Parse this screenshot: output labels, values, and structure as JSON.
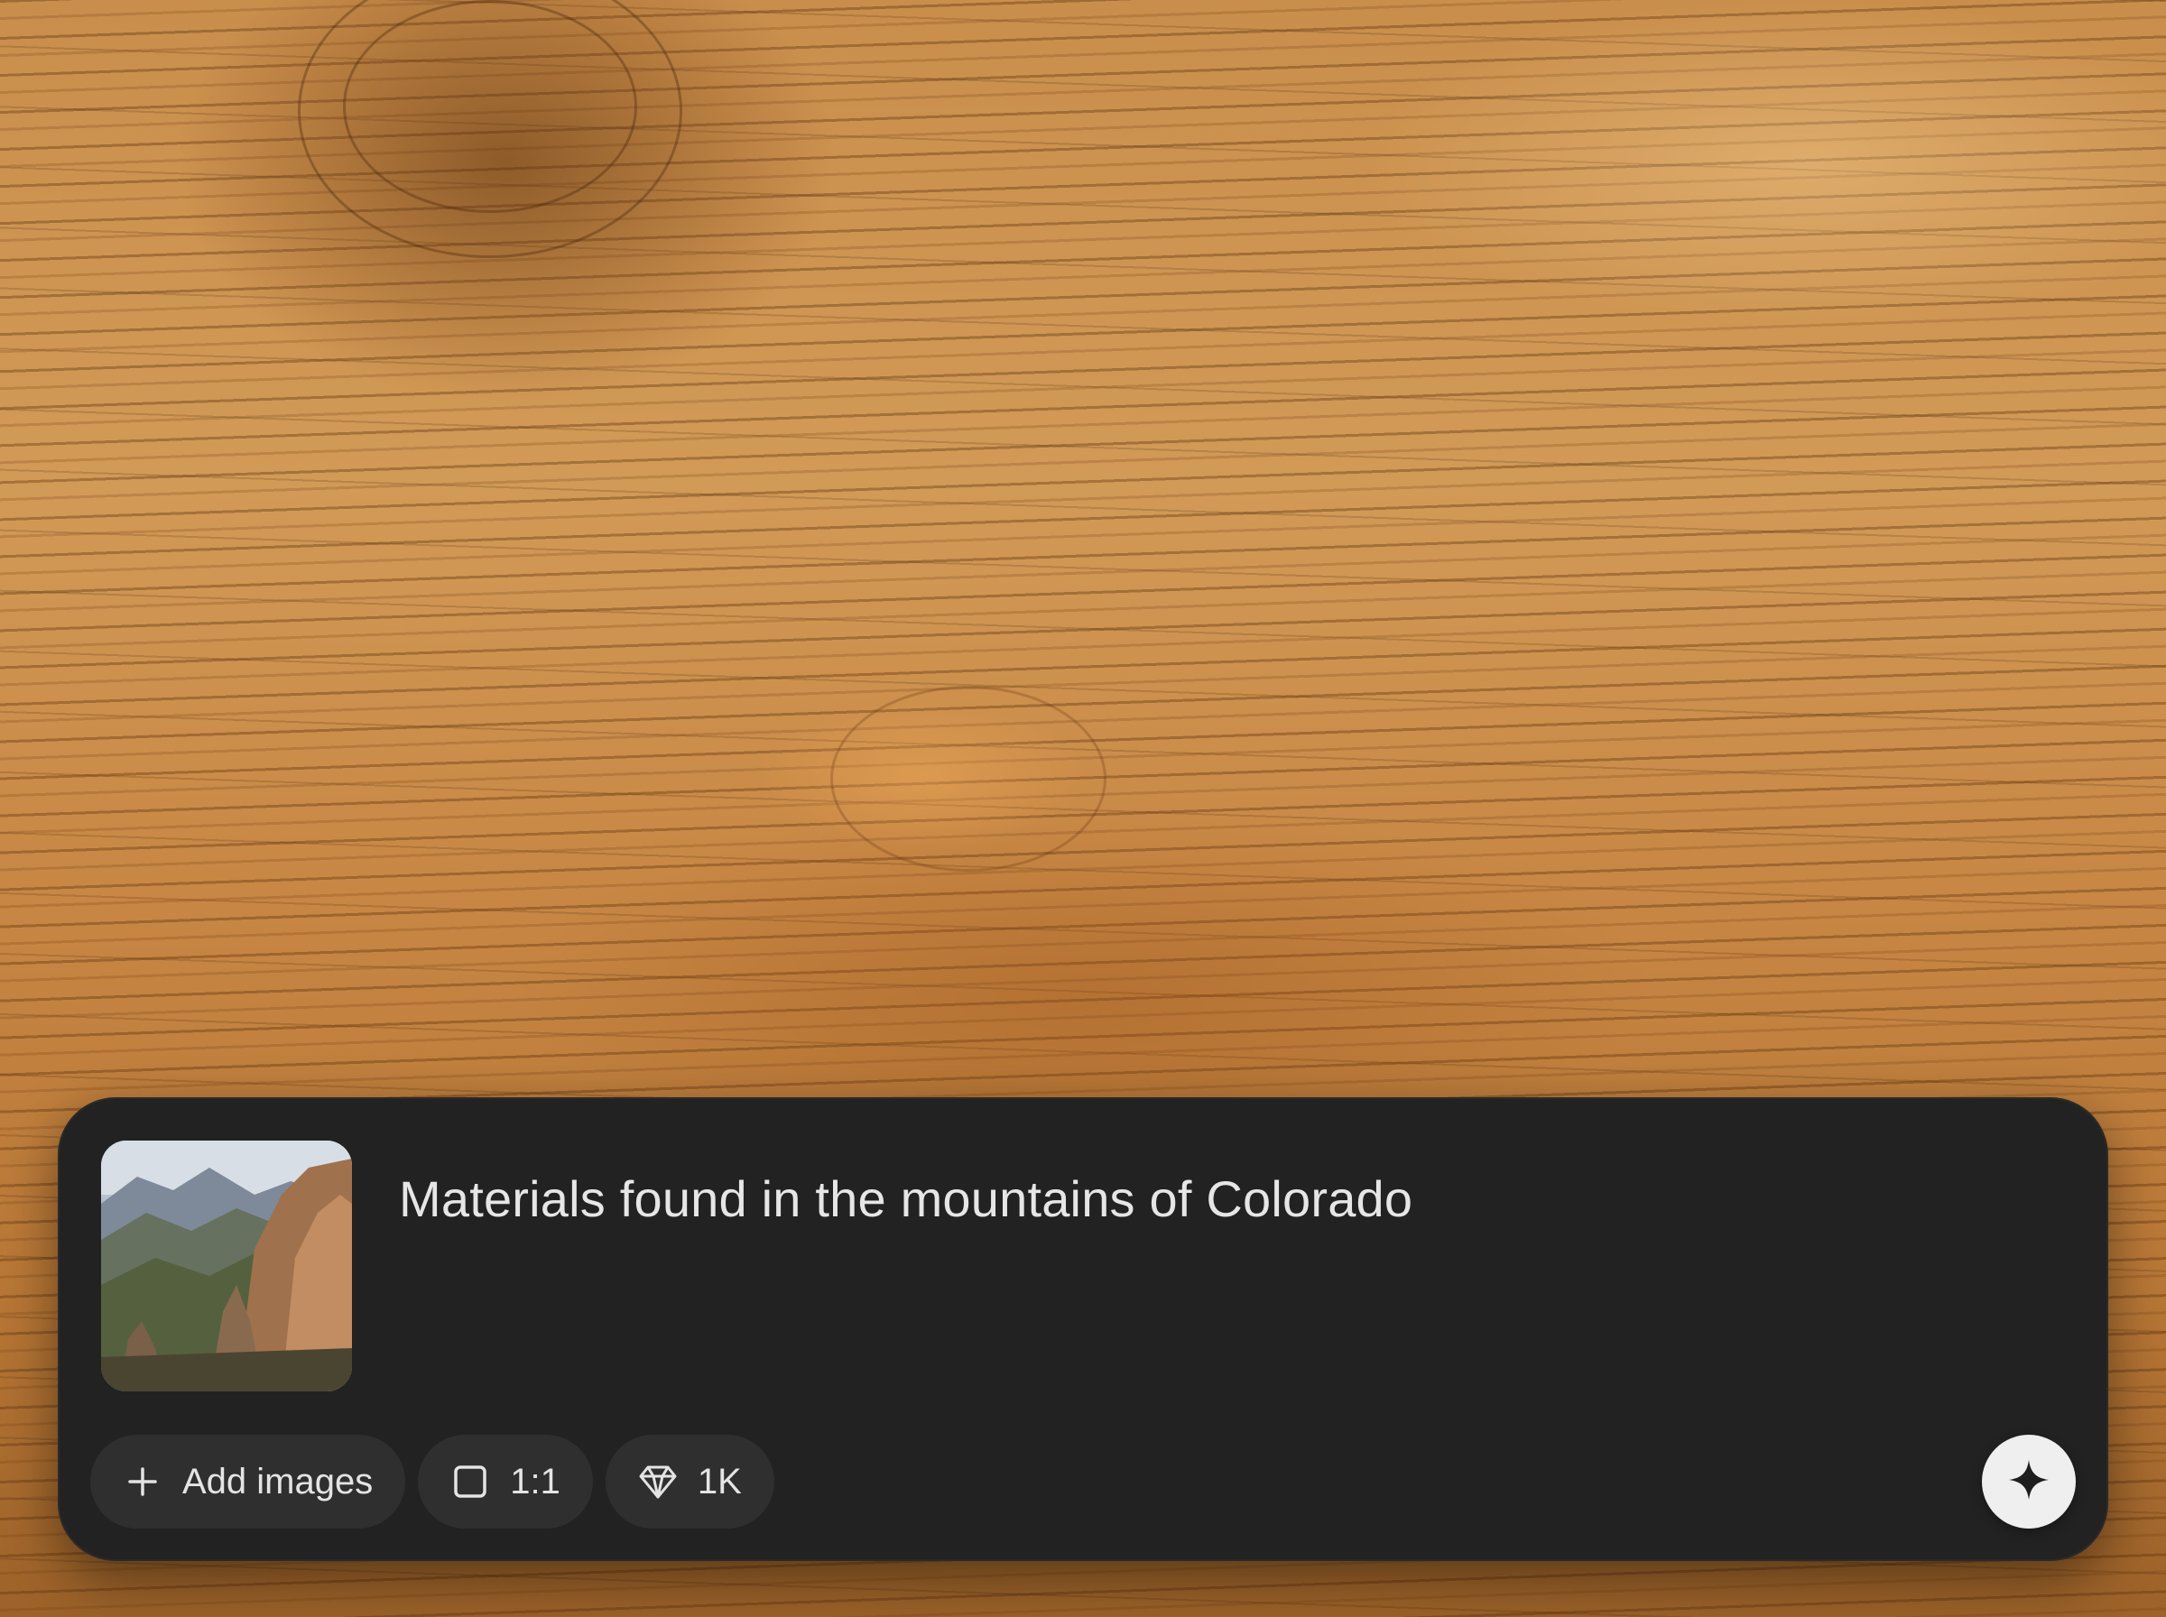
{
  "prompt": {
    "text": "Materials found in the mountains of Colorado"
  },
  "toolbar": {
    "add_images_label": "Add images",
    "aspect_ratio_label": "1:1",
    "resolution_label": "1K"
  },
  "icons": {
    "add": "plus-icon",
    "aspect_ratio": "square-icon",
    "resolution": "diamond-icon",
    "generate": "sparkle-icon"
  },
  "colors": {
    "panel_background": "#222222",
    "chip_background": "#2f2f2f",
    "text": "#e6e6e6",
    "generate_button": "#efefef"
  }
}
